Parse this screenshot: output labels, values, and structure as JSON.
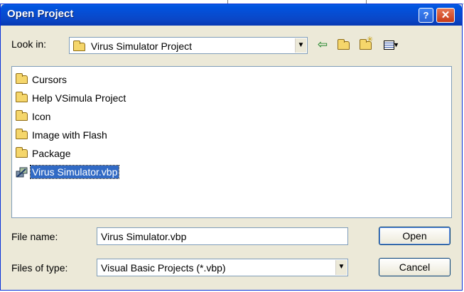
{
  "dialog": {
    "title": "Open Project",
    "help_glyph": "?",
    "close_glyph": "✕"
  },
  "look_in": {
    "label": "Look in:",
    "value": "Virus Simulator Project",
    "icon": "folder-icon",
    "toolbar": {
      "back": "⇦",
      "up": "⇧",
      "new_folder": "✳",
      "view_menu": "▾"
    }
  },
  "files": [
    {
      "name": "Cursors",
      "icon": "folder-icon",
      "selected": false
    },
    {
      "name": "Help VSimula Project",
      "icon": "folder-icon",
      "selected": false
    },
    {
      "name": "Icon",
      "icon": "folder-icon",
      "selected": false
    },
    {
      "name": "Image with Flash",
      "icon": "folder-icon",
      "selected": false
    },
    {
      "name": "Package",
      "icon": "folder-icon",
      "selected": false
    },
    {
      "name": "Virus Simulator.vbp",
      "icon": "vb-project-icon",
      "selected": true
    }
  ],
  "file_name": {
    "label": "File name:",
    "value": "Virus Simulator.vbp"
  },
  "file_type": {
    "label": "Files of type:",
    "value": "Visual Basic Projects (*.vbp)"
  },
  "buttons": {
    "open": "Open",
    "cancel": "Cancel"
  },
  "colors": {
    "title_bar": "#0a47c7",
    "face": "#ece9d8",
    "selection": "#316ac5",
    "border": "#7f9db9"
  }
}
